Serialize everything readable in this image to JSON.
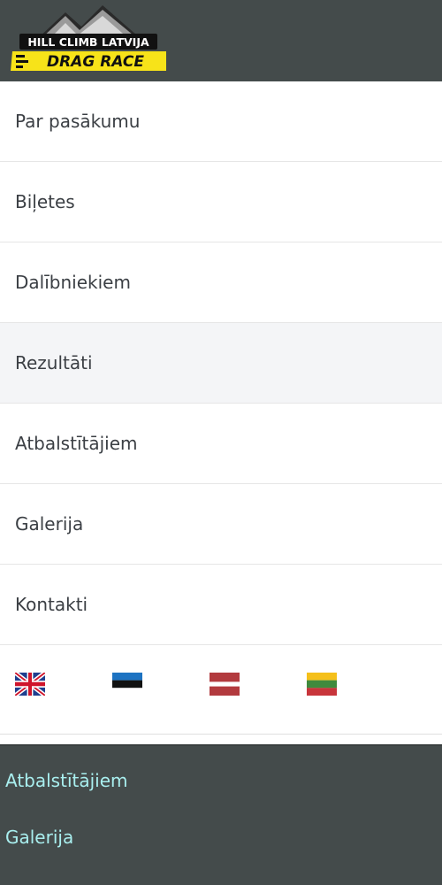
{
  "header": {
    "logo_line1": "HILL CLIMB LATVIJA",
    "logo_line2": "DRAG RACE",
    "bg_color": "#444b4b",
    "logo_accent": "#f7e319"
  },
  "menu": {
    "items": [
      {
        "label": "Par pasākumu"
      },
      {
        "label": "Biļetes"
      },
      {
        "label": "Dalībniekiem"
      },
      {
        "label": "Rezultāti"
      },
      {
        "label": "Atbalstītājiem"
      },
      {
        "label": "Galerija"
      },
      {
        "label": "Kontakti"
      }
    ]
  },
  "languages": [
    {
      "icon": "uk-flag-icon"
    },
    {
      "icon": "estonia-flag-icon"
    },
    {
      "icon": "latvia-flag-icon"
    },
    {
      "icon": "lithuania-flag-icon"
    }
  ],
  "footer": {
    "links": [
      {
        "label": "Atbalstītājiem"
      },
      {
        "label": "Galerija"
      }
    ],
    "link_color": "#a9efef"
  }
}
